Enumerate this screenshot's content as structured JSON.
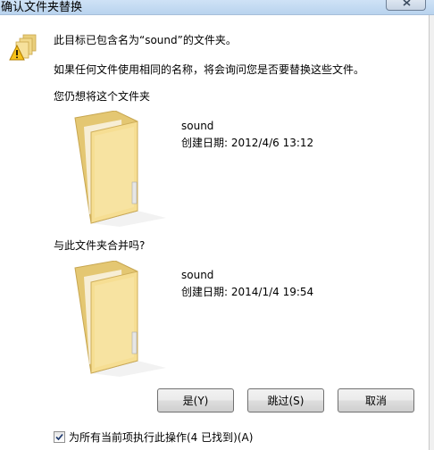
{
  "window": {
    "title": "确认文件夹替换"
  },
  "dialog": {
    "line1": "此目标已包含名为“sound”的文件夹。",
    "line2": "如果任何文件使用相同的名称，将会询问您是否要替换这些文件。",
    "prompt_keep": "您仍想将这个文件夹",
    "existing": {
      "name": "sound",
      "date": "创建日期: 2012/4/6 13:12"
    },
    "prompt_merge": "与此文件夹合并吗?",
    "incoming": {
      "name": "sound",
      "date": "创建日期: 2014/1/4 19:54"
    }
  },
  "buttons": {
    "yes": "是(Y)",
    "skip": "跳过(S)",
    "cancel": "取消"
  },
  "apply_all": {
    "label": "为所有当前项执行此操作(4 已找到)(A)",
    "checked": true
  },
  "icons": {
    "warning": "warning-icon",
    "folder": "folder-icon",
    "close": "close-icon",
    "checkmark": "checkmark-icon"
  },
  "colors": {
    "title_bar": "#c4daf2",
    "folder": "#f3d98a",
    "warning": "#f7c21a"
  }
}
